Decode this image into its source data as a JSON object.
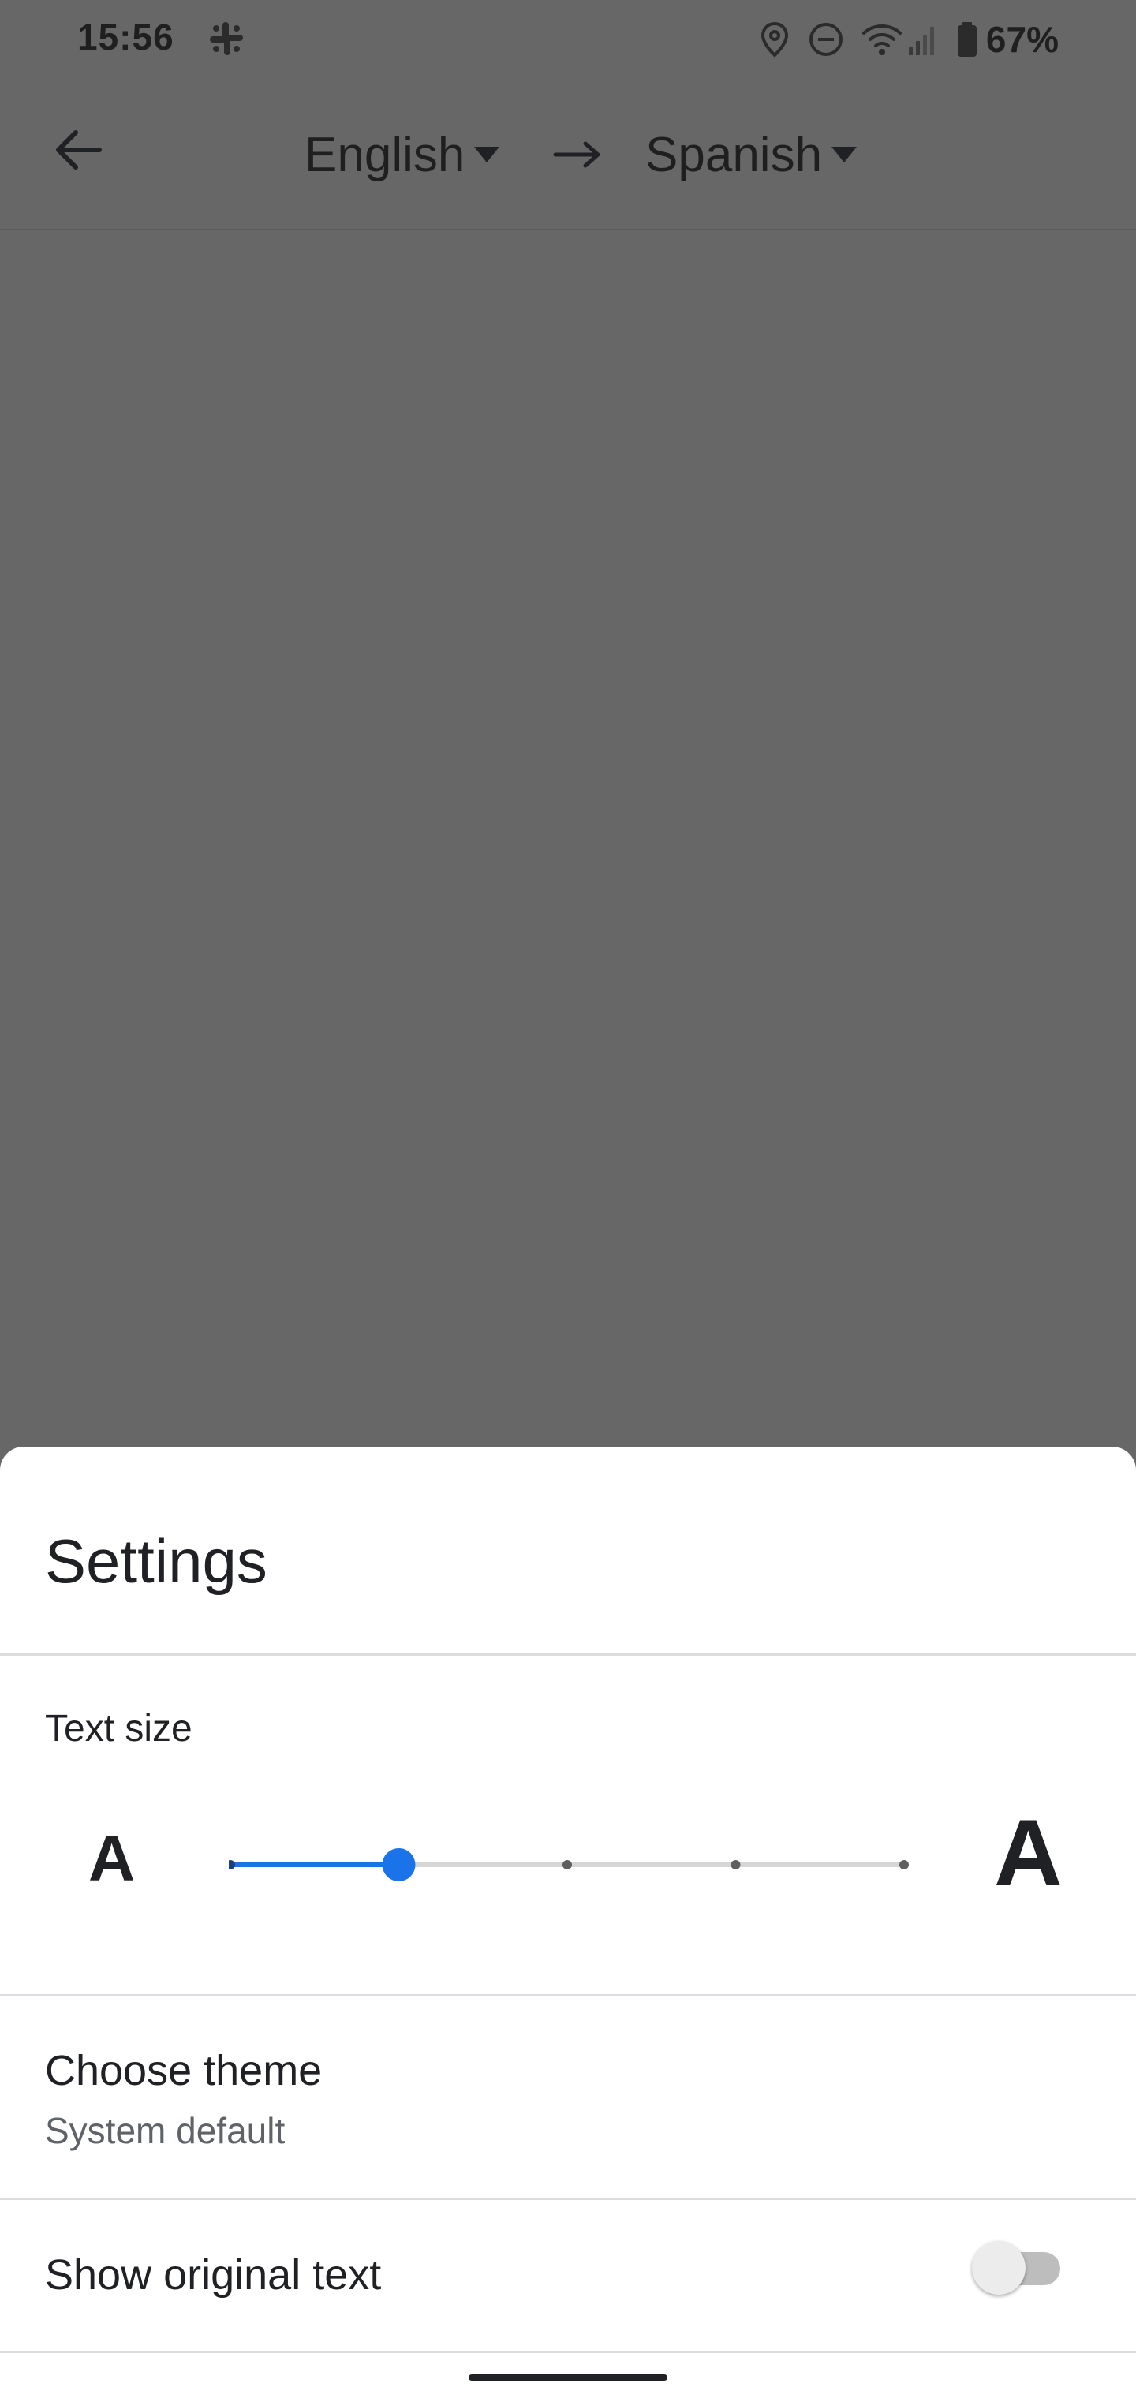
{
  "status_bar": {
    "time": "15:56",
    "app_icon": "slack-icon",
    "icons": [
      "location-icon",
      "do-not-disturb-icon",
      "wifi-icon",
      "cell-signal-icon",
      "battery-icon"
    ],
    "battery": "67%"
  },
  "toolbar": {
    "back_icon": "arrow-back-icon",
    "source_language": "English",
    "target_language": "Spanish",
    "swap_icon": "arrow-right-icon"
  },
  "settings": {
    "title": "Settings",
    "text_size": {
      "label": "Text size",
      "small_glyph": "A",
      "large_glyph": "A",
      "steps": 5,
      "selected_step": 1,
      "accent_color": "#1a73e8"
    },
    "theme": {
      "title": "Choose theme",
      "value": "System default"
    },
    "show_original_text": {
      "label": "Show original text",
      "enabled": false
    }
  }
}
